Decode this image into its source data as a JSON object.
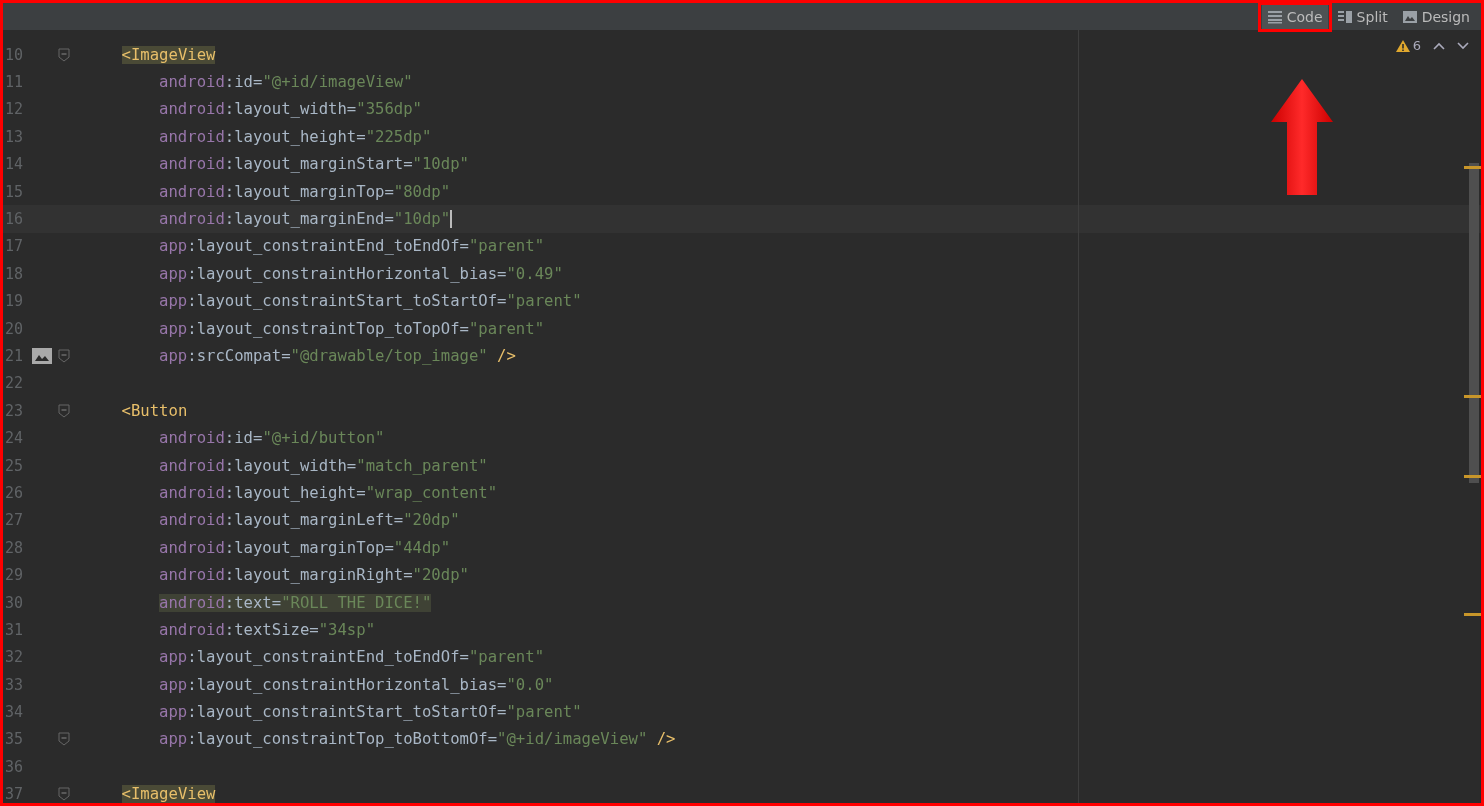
{
  "view_tabs": [
    {
      "label": "Code",
      "selected": true
    },
    {
      "label": "Split",
      "selected": false
    },
    {
      "label": "Design",
      "selected": false
    }
  ],
  "warnings": {
    "count": "6"
  },
  "lines": [
    {
      "n": "10",
      "kind": "tag",
      "bracket": "<",
      "tag": "ImageView",
      "fold": true,
      "tag_highlight": true
    },
    {
      "n": "11",
      "kind": "attr",
      "ns": "android",
      "attr": ":id=",
      "value": "\"@+id/imageView\""
    },
    {
      "n": "12",
      "kind": "attr",
      "ns": "android",
      "attr": ":layout_width=",
      "value": "\"356dp\""
    },
    {
      "n": "13",
      "kind": "attr",
      "ns": "android",
      "attr": ":layout_height=",
      "value": "\"225dp\""
    },
    {
      "n": "14",
      "kind": "attr",
      "ns": "android",
      "attr": ":layout_marginStart=",
      "value": "\"10dp\""
    },
    {
      "n": "15",
      "kind": "attr",
      "ns": "android",
      "attr": ":layout_marginTop=",
      "value": "\"80dp\""
    },
    {
      "n": "16",
      "kind": "attr",
      "ns": "android",
      "attr": ":layout_marginEnd=",
      "value": "\"10dp\"",
      "current": true
    },
    {
      "n": "17",
      "kind": "attr",
      "ns": "app",
      "attr": ":layout_constraintEnd_toEndOf=",
      "value": "\"parent\""
    },
    {
      "n": "18",
      "kind": "attr",
      "ns": "app",
      "attr": ":layout_constraintHorizontal_bias=",
      "value": "\"0.49\""
    },
    {
      "n": "19",
      "kind": "attr",
      "ns": "app",
      "attr": ":layout_constraintStart_toStartOf=",
      "value": "\"parent\""
    },
    {
      "n": "20",
      "kind": "attr",
      "ns": "app",
      "attr": ":layout_constraintTop_toTopOf=",
      "value": "\"parent\""
    },
    {
      "n": "21",
      "kind": "attr",
      "ns": "app",
      "attr": ":srcCompat=",
      "value": "\"@drawable/top_image\"",
      "close": " />",
      "fold": true,
      "gutter_image": true
    },
    {
      "n": "22",
      "kind": "blank"
    },
    {
      "n": "23",
      "kind": "tag",
      "bracket": "<",
      "tag": "Button",
      "fold": true
    },
    {
      "n": "24",
      "kind": "attr",
      "ns": "android",
      "attr": ":id=",
      "value": "\"@+id/button\""
    },
    {
      "n": "25",
      "kind": "attr",
      "ns": "android",
      "attr": ":layout_width=",
      "value": "\"match_parent\""
    },
    {
      "n": "26",
      "kind": "attr",
      "ns": "android",
      "attr": ":layout_height=",
      "value": "\"wrap_content\""
    },
    {
      "n": "27",
      "kind": "attr",
      "ns": "android",
      "attr": ":layout_marginLeft=",
      "value": "\"20dp\""
    },
    {
      "n": "28",
      "kind": "attr",
      "ns": "android",
      "attr": ":layout_marginTop=",
      "value": "\"44dp\""
    },
    {
      "n": "29",
      "kind": "attr",
      "ns": "android",
      "attr": ":layout_marginRight=",
      "value": "\"20dp\""
    },
    {
      "n": "30",
      "kind": "attr",
      "ns": "android",
      "attr": ":text=",
      "value": "\"ROLL THE DICE!\"",
      "highlighted": true
    },
    {
      "n": "31",
      "kind": "attr",
      "ns": "android",
      "attr": ":textSize=",
      "value": "\"34sp\""
    },
    {
      "n": "32",
      "kind": "attr",
      "ns": "app",
      "attr": ":layout_constraintEnd_toEndOf=",
      "value": "\"parent\""
    },
    {
      "n": "33",
      "kind": "attr",
      "ns": "app",
      "attr": ":layout_constraintHorizontal_bias=",
      "value": "\"0.0\""
    },
    {
      "n": "34",
      "kind": "attr",
      "ns": "app",
      "attr": ":layout_constraintStart_toStartOf=",
      "value": "\"parent\""
    },
    {
      "n": "35",
      "kind": "attr",
      "ns": "app",
      "attr": ":layout_constraintTop_toBottomOf=",
      "value": "\"@+id/imageView\"",
      "close": " />",
      "fold": true
    },
    {
      "n": "36",
      "kind": "blank"
    },
    {
      "n": "37",
      "kind": "tag",
      "bracket": "<",
      "tag": "ImageView",
      "fold": true,
      "tag_highlight": true
    }
  ]
}
